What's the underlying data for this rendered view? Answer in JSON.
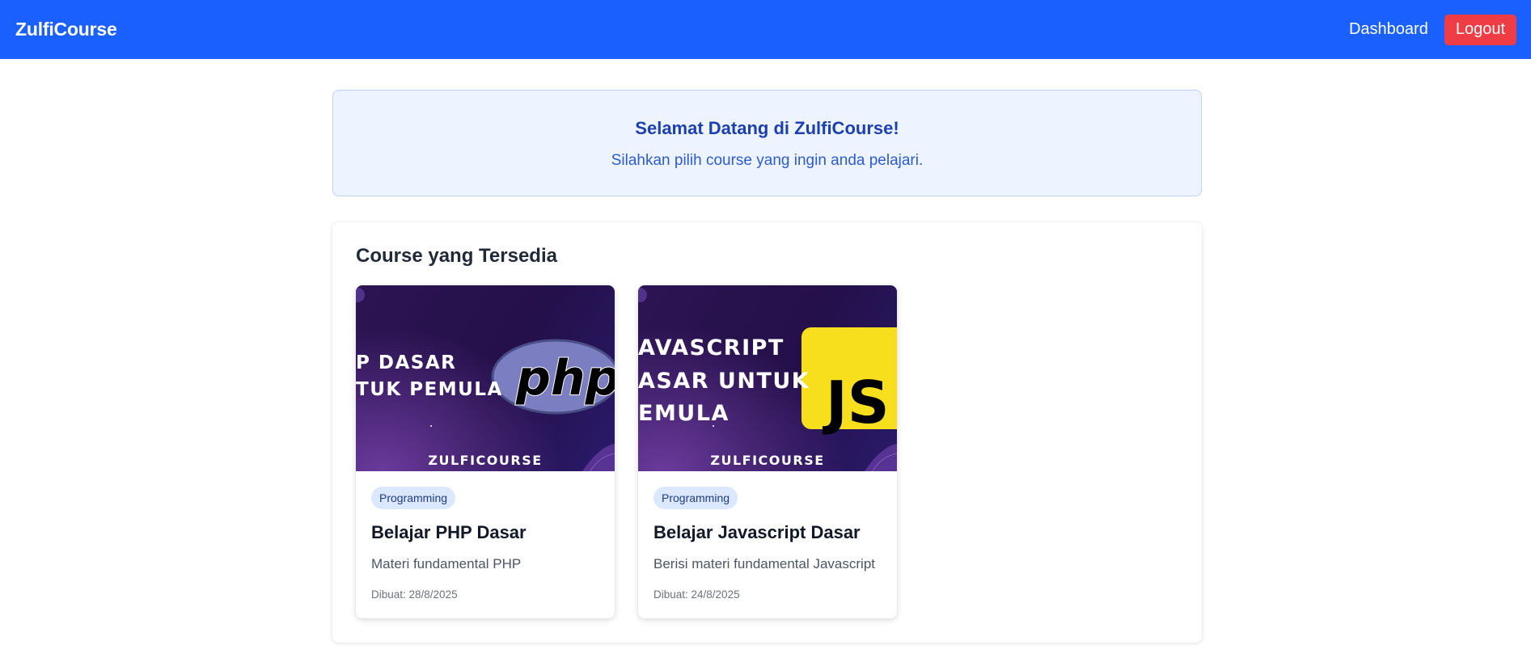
{
  "navbar": {
    "brand": "ZulfiCourse",
    "dashboard_label": "Dashboard",
    "logout_label": "Logout",
    "color": "#1a60ff",
    "logout_color": "#ef3c45"
  },
  "welcome": {
    "title": "Selamat Datang di ZulfiCourse!",
    "subtitle": "Silahkan pilih course yang ingin anda pelajari."
  },
  "courses_section": {
    "title": "Course yang Tersedia",
    "courses": [
      {
        "thumbnail_text": "P DASAR\nTUK PEMULA",
        "thumbnail_logo": "php",
        "thumbnail_brand": "ZULFICOURSE",
        "category": "Programming",
        "title": "Belajar PHP Dasar",
        "description": "Materi fundamental PHP",
        "created": "Dibuat: 28/8/2025"
      },
      {
        "thumbnail_text": "AVASCRIPT\nASAR UNTUK\nEMULA",
        "thumbnail_logo": "JS",
        "thumbnail_brand": "ZULFICOURSE",
        "category": "Programming",
        "title": "Belajar Javascript Dasar",
        "description": "Berisi materi fundamental Javascript",
        "created": "Dibuat: 24/8/2025"
      }
    ]
  }
}
